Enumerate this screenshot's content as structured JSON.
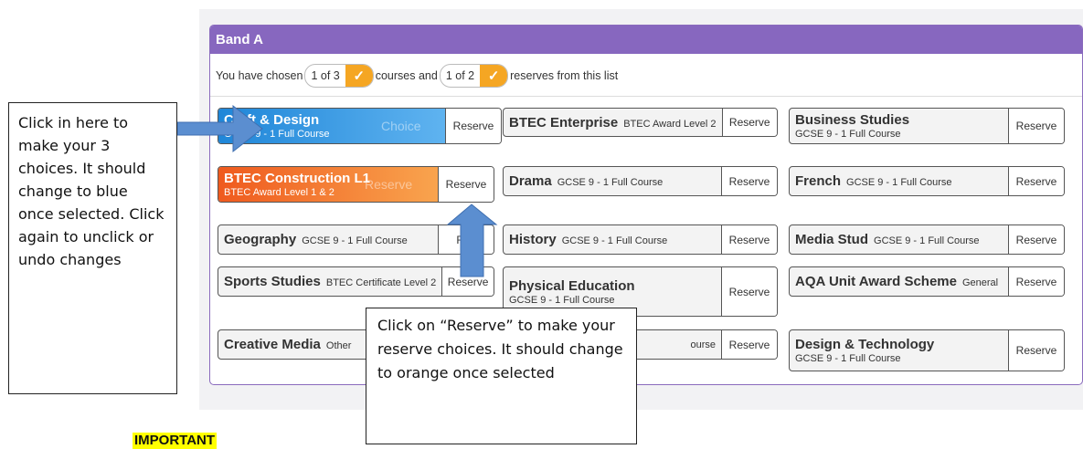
{
  "band": {
    "title": "Band A",
    "status": {
      "prefix": "You have chosen",
      "chosen_count": "1 of 3",
      "middle": "courses and",
      "reserve_count": "1 of 2",
      "suffix": "reserves from this list"
    }
  },
  "courses": [
    {
      "title": "Craft & Design",
      "subtitle": "GCSE 9 - 1 Full Course",
      "reserve_label": "Reserve",
      "state": "choice",
      "ghost_label": "Choice"
    },
    {
      "title": "BTEC Enterprise",
      "subtitle": "BTEC Award Level 2",
      "reserve_label": "Reserve",
      "state": "none"
    },
    {
      "title": "Business Studies",
      "subtitle": "GCSE 9 - 1 Full Course",
      "reserve_label": "Reserve",
      "state": "none"
    },
    {
      "title": "BTEC Construction L1",
      "subtitle": "BTEC Award Level 1 & 2",
      "reserve_label": "Reserve",
      "state": "reserve",
      "ghost_label": "Reserve"
    },
    {
      "title": "Drama",
      "subtitle": "GCSE 9 - 1 Full Course",
      "reserve_label": "Reserve",
      "state": "none"
    },
    {
      "title": "French",
      "subtitle": "GCSE 9 - 1 Full Course",
      "reserve_label": "Reserve",
      "state": "none"
    },
    {
      "title": "Geography",
      "subtitle": "GCSE 9 - 1 Full Course",
      "reserve_label": "Res",
      "state": "none"
    },
    {
      "title": "History",
      "subtitle": "GCSE 9 - 1 Full Course",
      "reserve_label": "Reserve",
      "state": "none"
    },
    {
      "title": "Media Stud",
      "subtitle": "GCSE 9 - 1 Full Course",
      "reserve_label": "Reserve",
      "state": "none"
    },
    {
      "title": "Sports Studies",
      "subtitle": "BTEC Certificate Level 2",
      "reserve_label": "Reserve",
      "state": "none"
    },
    {
      "title": "Physical Education",
      "subtitle": "GCSE 9 - 1 Full Course",
      "reserve_label": "Reserve",
      "state": "none"
    },
    {
      "title": "AQA Unit Award Scheme",
      "subtitle": "General",
      "reserve_label": "Reserve",
      "state": "none"
    },
    {
      "title": "Creative Media",
      "subtitle": "Other",
      "reserve_label": "",
      "state": "none"
    },
    {
      "title": "",
      "subtitle": "ourse",
      "reserve_label": "Reserve",
      "state": "none"
    },
    {
      "title": "Design & Technology",
      "subtitle": "GCSE 9 - 1 Full Course",
      "reserve_label": "Reserve",
      "state": "none"
    }
  ],
  "callouts": {
    "choices": "Click in here to make your 3 choices. It should change to blue once selected. Click again to unclick or undo changes",
    "reserve": "Click on “Reserve” to make your reserve choices. It should change to orange once selected"
  },
  "important_label": "IMPORTANT",
  "colors": {
    "band_header": "#8767bf",
    "choice": "#1f86d8",
    "reserve": "#ef5a1e",
    "check": "#f5a623",
    "arrow": "#5b8ed0"
  }
}
